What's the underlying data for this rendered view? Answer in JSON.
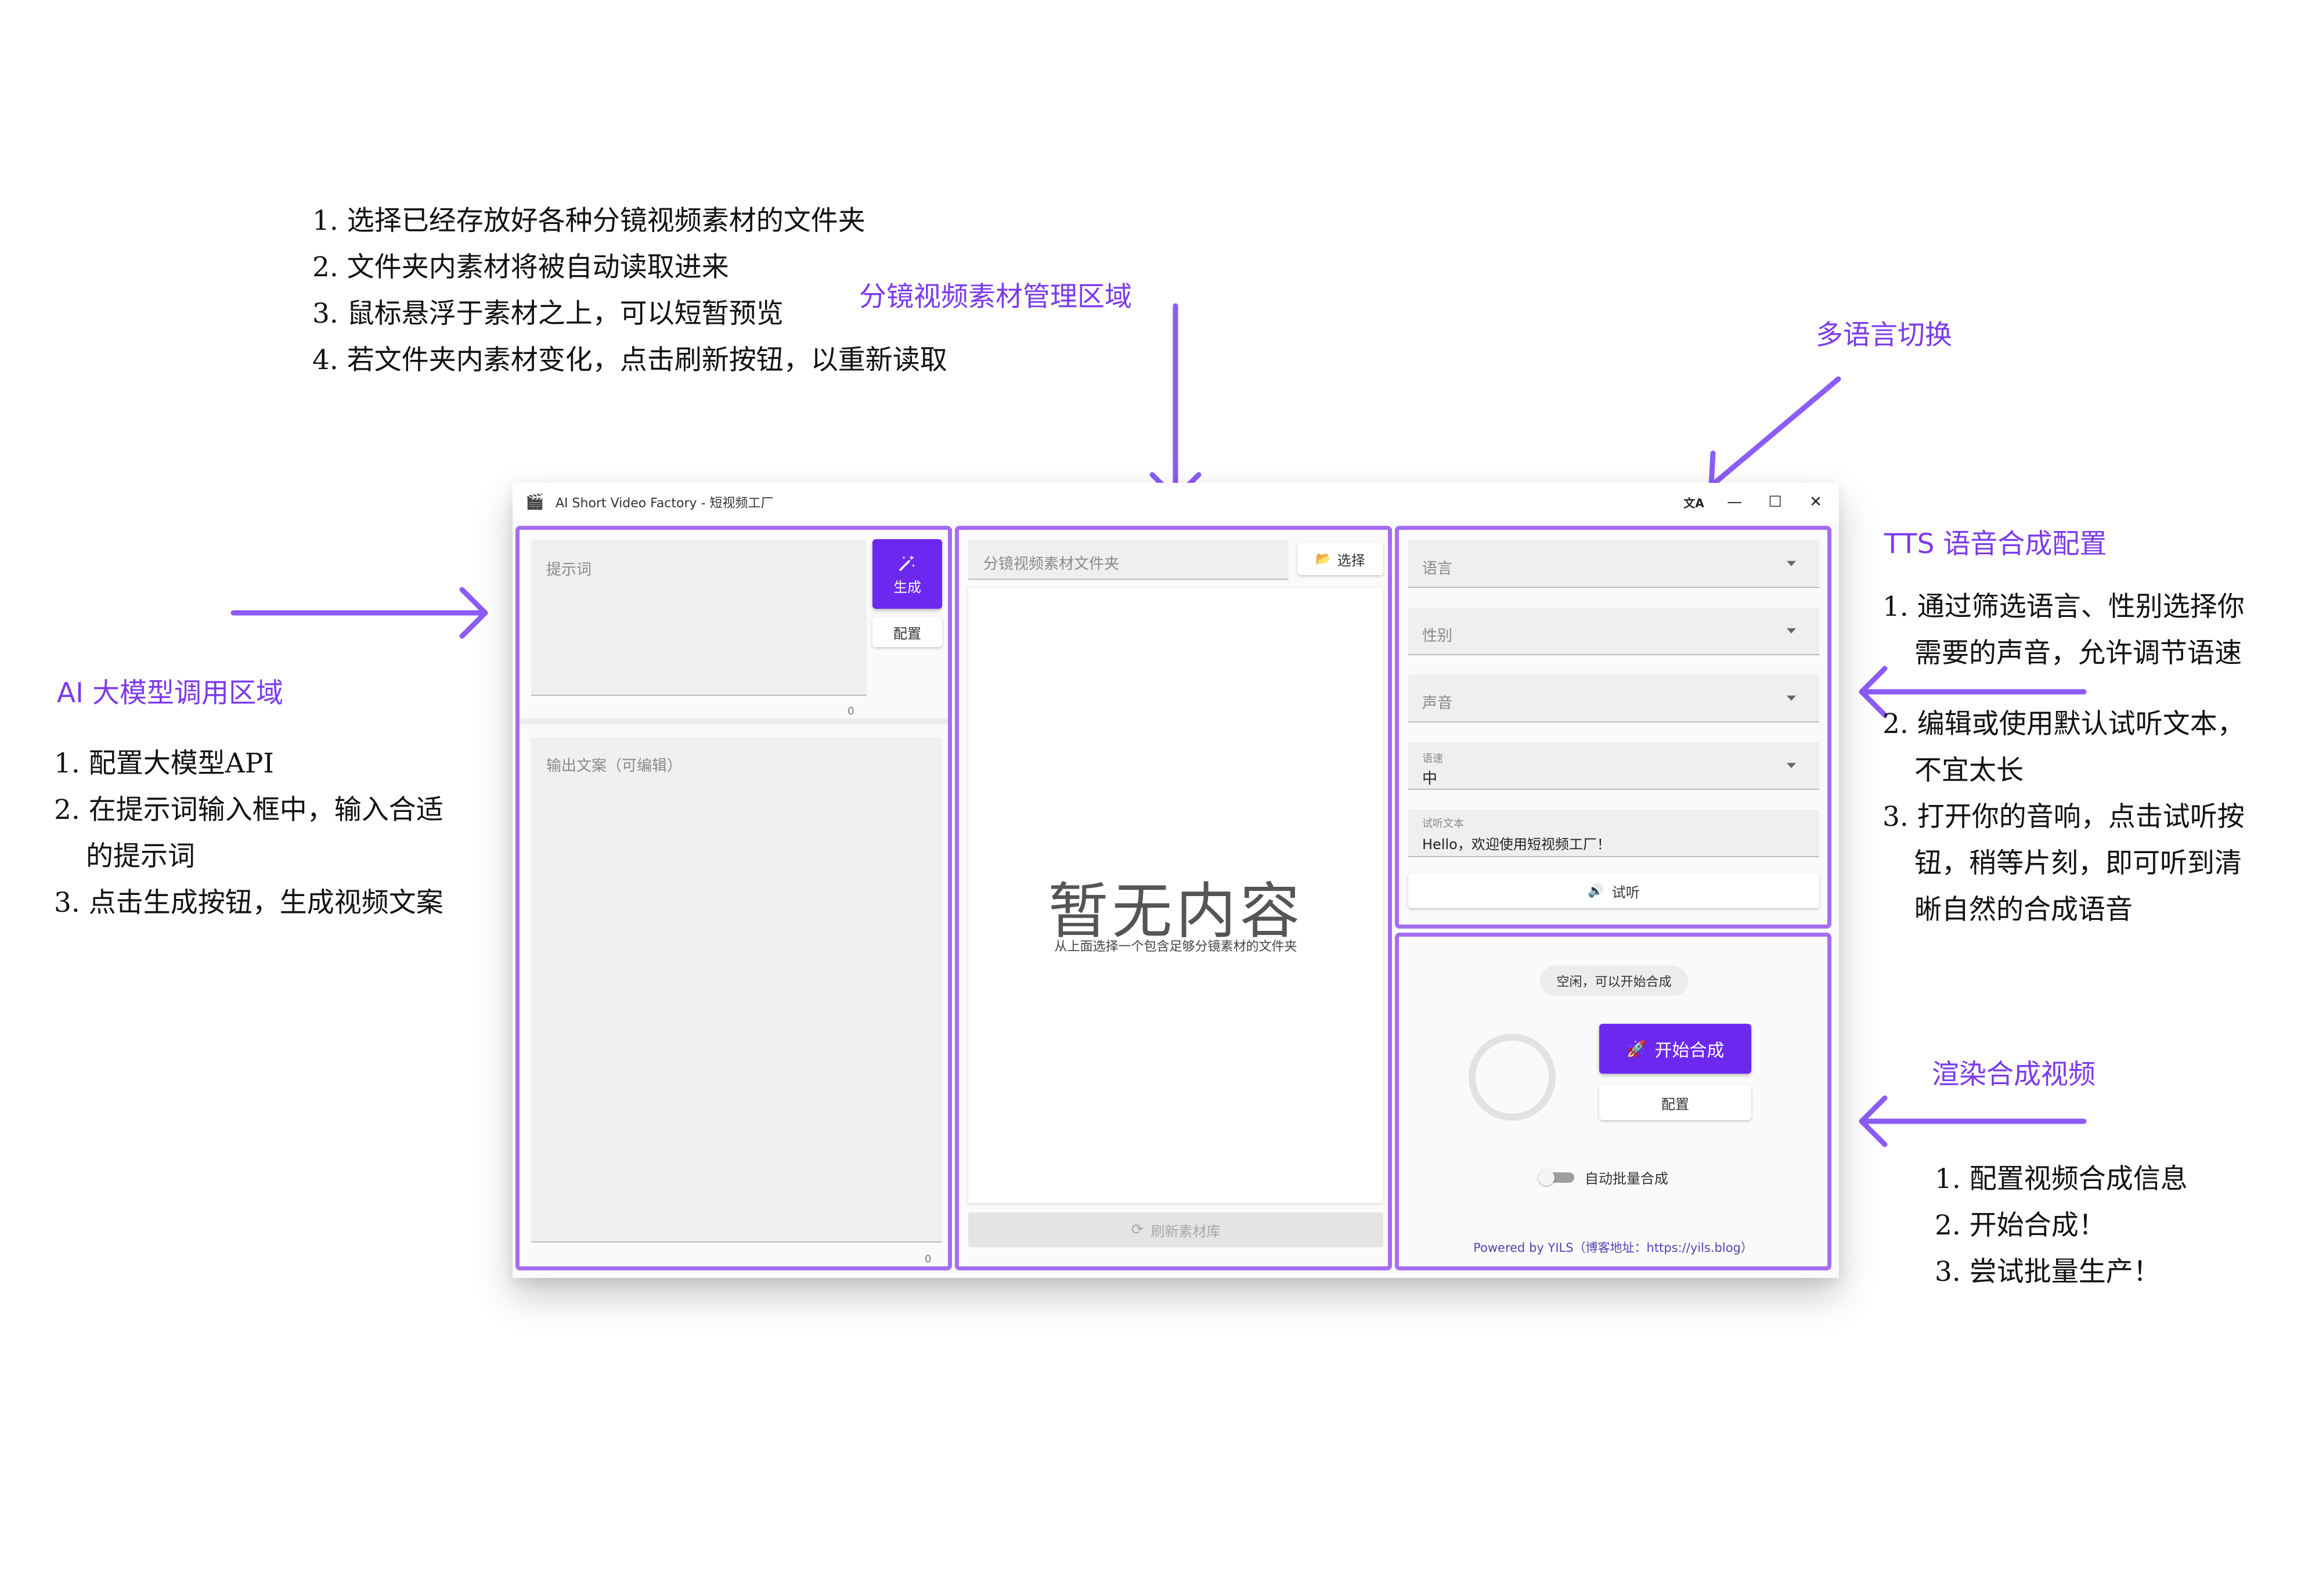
{
  "annotations": {
    "top_steps": [
      "1. 选择已经存放好各种分镜视频素材的文件夹",
      "2. 文件夹内素材将被自动读取进来",
      "3. 鼠标悬浮于素材之上，可以短暂预览",
      "4. 若文件夹内素材变化，点击刷新按钮，以重新读取"
    ],
    "material_area_title": "分镜视频素材管理区域",
    "language_switch_title": "多语言切换",
    "ai_area_title": "AI 大模型调用区域",
    "ai_steps": [
      "1. 配置大模型API",
      "2. 在提示词输入框中，输入合适",
      "的提示词",
      "3. 点击生成按钮，生成视频文案"
    ],
    "tts_title": "TTS 语音合成配置",
    "tts_steps": [
      "1. 通过筛选语言、性别选择你",
      "需要的声音，允许调节语速",
      "2. 编辑或使用默认试听文本，",
      "不宜太长",
      "3. 打开你的音响，点击试听按",
      "钮，稍等片刻，即可听到清",
      "晰自然的合成语音"
    ],
    "render_title": "渲染合成视频",
    "render_steps": [
      "1. 配置视频合成信息",
      "2. 开始合成！",
      "3. 尝试批量生产！"
    ]
  },
  "window": {
    "title": "AI Short Video Factory - 短视频工厂",
    "controls": {
      "translate": "文A",
      "minimize": "—",
      "maximize": "☐",
      "close": "✕"
    }
  },
  "ai_panel": {
    "prompt_placeholder": "提示词",
    "prompt_count": "0",
    "generate_label": "生成",
    "config_label": "配置",
    "output_placeholder": "输出文案（可编辑）",
    "output_count": "0"
  },
  "material_panel": {
    "folder_placeholder": "分镜视频素材文件夹",
    "select_label": "选择",
    "empty_title": "暂无内容",
    "empty_hint": "从上面选择一个包含足够分镜素材的文件夹",
    "refresh_label": "刷新素材库"
  },
  "tts_panel": {
    "language_label": "语言",
    "gender_label": "性别",
    "voice_label": "声音",
    "speed_label": "语速",
    "speed_value": "中",
    "preview_text_label": "试听文本",
    "preview_text_value": "Hello，欢迎使用短视频工厂！",
    "listen_label": "试听"
  },
  "render_panel": {
    "status": "空闲，可以开始合成",
    "start_label": "开始合成",
    "config_label": "配置",
    "batch_label": "自动批量合成",
    "batch_on": false,
    "footer": "Powered by YILS（博客地址：https://yils.blog）"
  },
  "colors": {
    "accent": "#6d28f0",
    "annotation": "#7c3aed",
    "panel_border": "#a56df0"
  }
}
